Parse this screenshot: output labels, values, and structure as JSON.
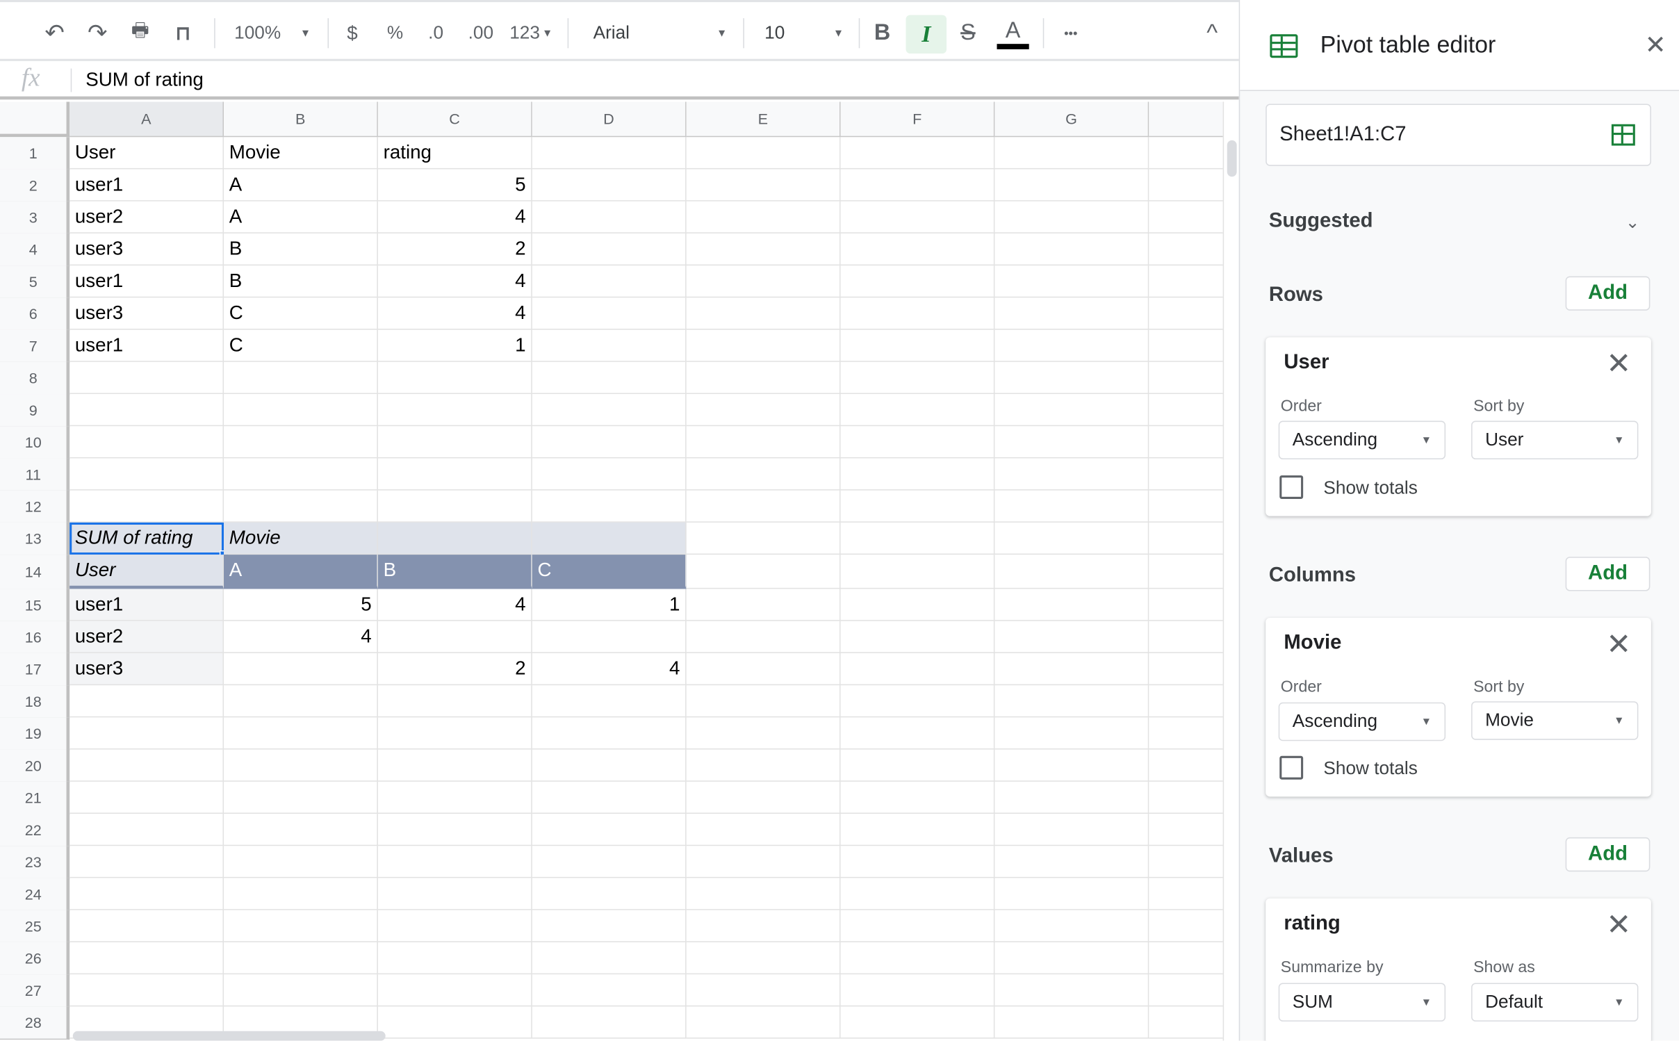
{
  "toolbar": {
    "zoom": "100%",
    "currency": "$",
    "percent": "%",
    "dec_decrease": ".0",
    "dec_increase": ".00",
    "more_formats": "123",
    "font": "Arial",
    "font_size": "10",
    "bold": "B",
    "italic": "I",
    "strike": "S",
    "text_color": "A",
    "more": "•••",
    "collapse": "^"
  },
  "formula_bar": {
    "fx": "fx",
    "value": "SUM of rating"
  },
  "columns": [
    "A",
    "B",
    "C",
    "D",
    "E",
    "F",
    "G"
  ],
  "row_count": 28,
  "sheet": {
    "1": [
      "User",
      "Movie",
      "rating"
    ],
    "2": [
      "user1",
      "A",
      "5"
    ],
    "3": [
      "user2",
      "A",
      "4"
    ],
    "4": [
      "user3",
      "B",
      "2"
    ],
    "5": [
      "user1",
      "B",
      "4"
    ],
    "6": [
      "user3",
      "C",
      "4"
    ],
    "7": [
      "user1",
      "C",
      "1"
    ],
    "13": [
      "SUM of rating",
      "Movie",
      "",
      ""
    ],
    "14": [
      "User",
      "A",
      "B",
      "C"
    ],
    "15": [
      "user1",
      "5",
      "4",
      "1"
    ],
    "16": [
      "user2",
      "4",
      "",
      ""
    ],
    "17": [
      "user3",
      "",
      "2",
      "4"
    ]
  },
  "colors": {
    "pivot_light": "#dfe3eb",
    "pivot_dark": "#8492af",
    "pivot_rowlabel": "#f3f4f6",
    "selection": "#1a73e8",
    "accent": "#188038"
  },
  "panel": {
    "title": "Pivot table editor",
    "close": "✕",
    "range": "Sheet1!A1:C7",
    "suggested": "Suggested",
    "add": "Add",
    "rows": {
      "label": "Rows",
      "field": "User",
      "order_label": "Order",
      "order": "Ascending",
      "sort_label": "Sort by",
      "sort": "User",
      "totals": "Show totals"
    },
    "columns": {
      "label": "Columns",
      "field": "Movie",
      "order_label": "Order",
      "order": "Ascending",
      "sort_label": "Sort by",
      "sort": "Movie",
      "totals": "Show totals"
    },
    "values": {
      "label": "Values",
      "field": "rating",
      "summarize_label": "Summarize by",
      "summarize": "SUM",
      "show_as_label": "Show as",
      "show_as": "Default"
    }
  }
}
